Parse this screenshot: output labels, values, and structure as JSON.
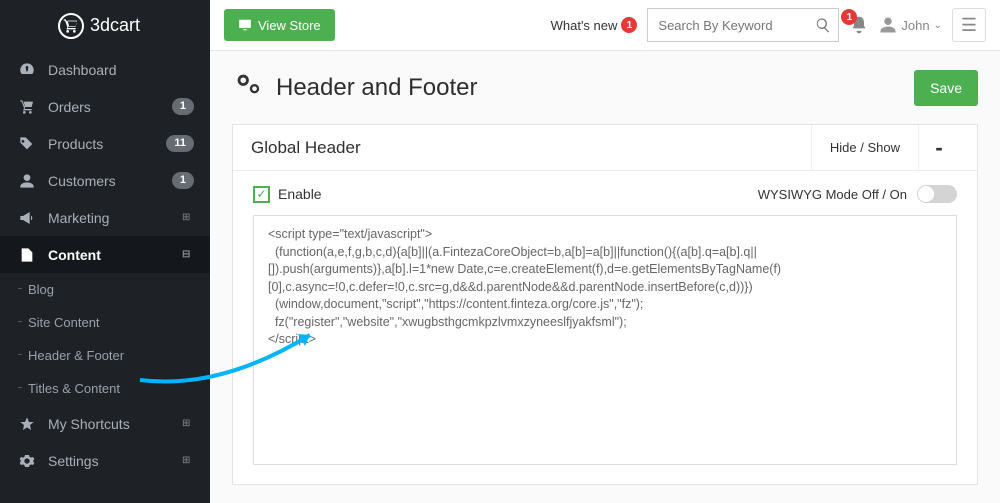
{
  "logo": {
    "text": "3dcart"
  },
  "nav": [
    {
      "icon": "dashboard",
      "label": "Dashboard"
    },
    {
      "icon": "cart",
      "label": "Orders",
      "badge": "1"
    },
    {
      "icon": "tags",
      "label": "Products",
      "badge": "11"
    },
    {
      "icon": "user",
      "label": "Customers",
      "badge": "1"
    },
    {
      "icon": "bullhorn",
      "label": "Marketing",
      "expand": "+"
    },
    {
      "icon": "file",
      "label": "Content",
      "expand": "-",
      "active": true,
      "subs": [
        {
          "label": "Blog"
        },
        {
          "label": "Site Content"
        },
        {
          "label": "Header & Footer"
        },
        {
          "label": "Titles & Content"
        }
      ]
    },
    {
      "icon": "star",
      "label": "My Shortcuts",
      "expand": "+"
    },
    {
      "icon": "gear",
      "label": "Settings",
      "expand": "+"
    }
  ],
  "topbar": {
    "view_store": "View Store",
    "whats_new": "What's new",
    "whats_new_badge": "1",
    "search_placeholder": "Search By Keyword",
    "bell_badge": "1",
    "user": "John"
  },
  "page": {
    "title": "Header and Footer",
    "save": "Save",
    "panel_title": "Global Header",
    "hide_show": "Hide / Show",
    "collapse": "-",
    "enable": "Enable",
    "wysiwyg": "WYSIWYG Mode Off / On",
    "code": "<script type=\"text/javascript\">\n  (function(a,e,f,g,b,c,d){a[b]||(a.FintezaCoreObject=b,a[b]=a[b]||function(){(a[b].q=a[b].q||[]).push(arguments)},a[b].l=1*new Date,c=e.createElement(f),d=e.getElementsByTagName(f)[0],c.async=!0,c.defer=!0,c.src=g,d&&d.parentNode&&d.parentNode.insertBefore(c,d))})\n  (window,document,\"script\",\"https://content.finteza.org/core.js\",\"fz\");\n  fz(\"register\",\"website\",\"xwugbsthgcmkpzlvmxzyneeslfjyakfsml\");\n</script>"
  }
}
